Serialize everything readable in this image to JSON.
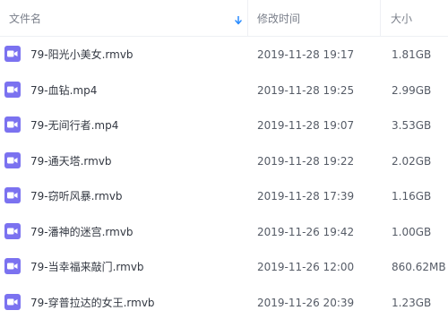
{
  "header": {
    "name_label": "文件名",
    "modified_label": "修改时间",
    "size_label": "大小",
    "sort_icon": "arrow-down-icon"
  },
  "colors": {
    "video_icon": "#7b72f0",
    "sort_icon": "#2a8cff"
  },
  "files": [
    {
      "name": "79-阳光小美女.rmvb",
      "modified": "2019-11-28 19:17",
      "size": "1.81GB",
      "icon": "video-file-icon"
    },
    {
      "name": "79-血钻.mp4",
      "modified": "2019-11-28 19:25",
      "size": "2.99GB",
      "icon": "video-file-icon"
    },
    {
      "name": "79-无间行者.mp4",
      "modified": "2019-11-28 19:07",
      "size": "3.53GB",
      "icon": "video-file-icon"
    },
    {
      "name": "79-通天塔.rmvb",
      "modified": "2019-11-28 19:22",
      "size": "2.02GB",
      "icon": "video-file-icon"
    },
    {
      "name": "79-窃听风暴.rmvb",
      "modified": "2019-11-28 17:39",
      "size": "1.16GB",
      "icon": "video-file-icon"
    },
    {
      "name": "79-潘神的迷宫.rmvb",
      "modified": "2019-11-26 19:42",
      "size": "1.00GB",
      "icon": "video-file-icon"
    },
    {
      "name": "79-当幸福来敲门.rmvb",
      "modified": "2019-11-26 12:00",
      "size": "860.62MB",
      "icon": "video-file-icon"
    },
    {
      "name": "79-穿普拉达的女王.rmvb",
      "modified": "2019-11-26 20:39",
      "size": "1.23GB",
      "icon": "video-file-icon"
    }
  ]
}
